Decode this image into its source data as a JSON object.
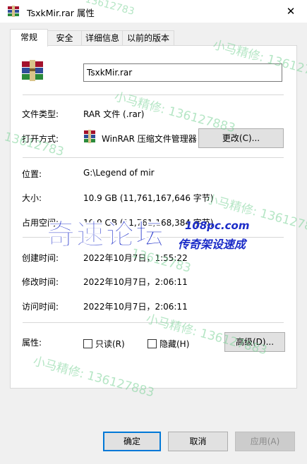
{
  "window": {
    "title": "TsxkMir.rar 属性",
    "close_glyph": "✕"
  },
  "tabs": [
    {
      "label": "常规",
      "active": true
    },
    {
      "label": "安全"
    },
    {
      "label": "详细信息"
    },
    {
      "label": "以前的版本"
    }
  ],
  "general": {
    "file_name": "TsxkMir.rar",
    "file_type_label": "文件类型:",
    "file_type_value": "RAR 文件 (.rar)",
    "opens_with_label": "打开方式:",
    "opens_with_value": "WinRAR 压缩文件管理器",
    "change_button": "更改(C)...",
    "location_label": "位置:",
    "location_value": "G:\\Legend of mir",
    "size_label": "大小:",
    "size_value": "10.9 GB (11,761,167,646 字节)",
    "size_on_disk_label": "占用空间:",
    "size_on_disk_value": "10.9 GB (11,761,168,384 字节)",
    "created_label": "创建时间:",
    "created_value": "2022年10月7日，1:55:22",
    "modified_label": "修改时间:",
    "modified_value": "2022年10月7日，2:06:11",
    "accessed_label": "访问时间:",
    "accessed_value": "2022年10月7日，2:06:11",
    "attributes_label": "属性:",
    "readonly_label": "只读(R)",
    "hidden_label": "隐藏(H)",
    "advanced_button": "高级(D)..."
  },
  "footer": {
    "ok": "确定",
    "cancel": "取消",
    "apply": "应用(A)"
  },
  "watermark": {
    "phrase_a": "小马精修: 13612788",
    "phrase_b": "小马精修: 136127883",
    "phrase_c": "13612783",
    "logo_main": "奇速论坛",
    "logo_domain": "108pc.com",
    "logo_sub": "传奇架设速成"
  },
  "colors": {
    "accent": "#0078d7",
    "winrar_red": "#a3112c",
    "winrar_blue": "#2f4e9a",
    "winrar_green": "#2a8a3a",
    "logo_blue": "#1b2cc8"
  },
  "icons": {
    "title": "winrar-archive-icon",
    "file": "winrar-archive-icon",
    "app": "winrar-app-icon"
  }
}
